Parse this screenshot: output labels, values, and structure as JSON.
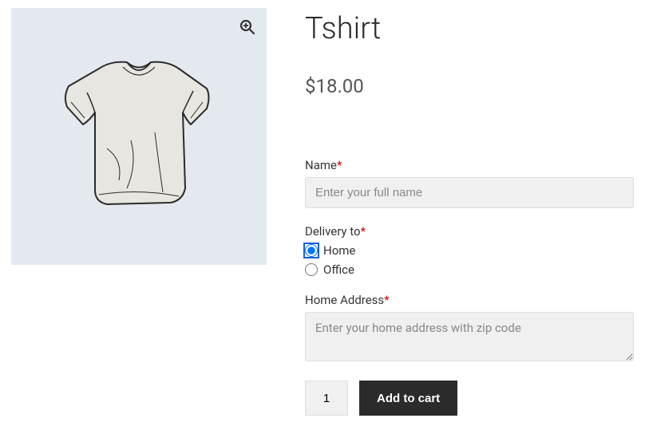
{
  "product": {
    "title": "Tshirt",
    "price": "$18.00"
  },
  "form": {
    "name": {
      "label": "Name",
      "placeholder": "Enter your full name",
      "required": "*"
    },
    "delivery": {
      "label": "Delivery to",
      "required": "*",
      "options": {
        "home": "Home",
        "office": "Office"
      }
    },
    "address": {
      "label": "Home Address",
      "required": "*",
      "placeholder": "Enter your home address with zip code"
    }
  },
  "cart": {
    "quantity": "1",
    "button": "Add to cart"
  },
  "icons": {
    "zoom": "zoom"
  }
}
